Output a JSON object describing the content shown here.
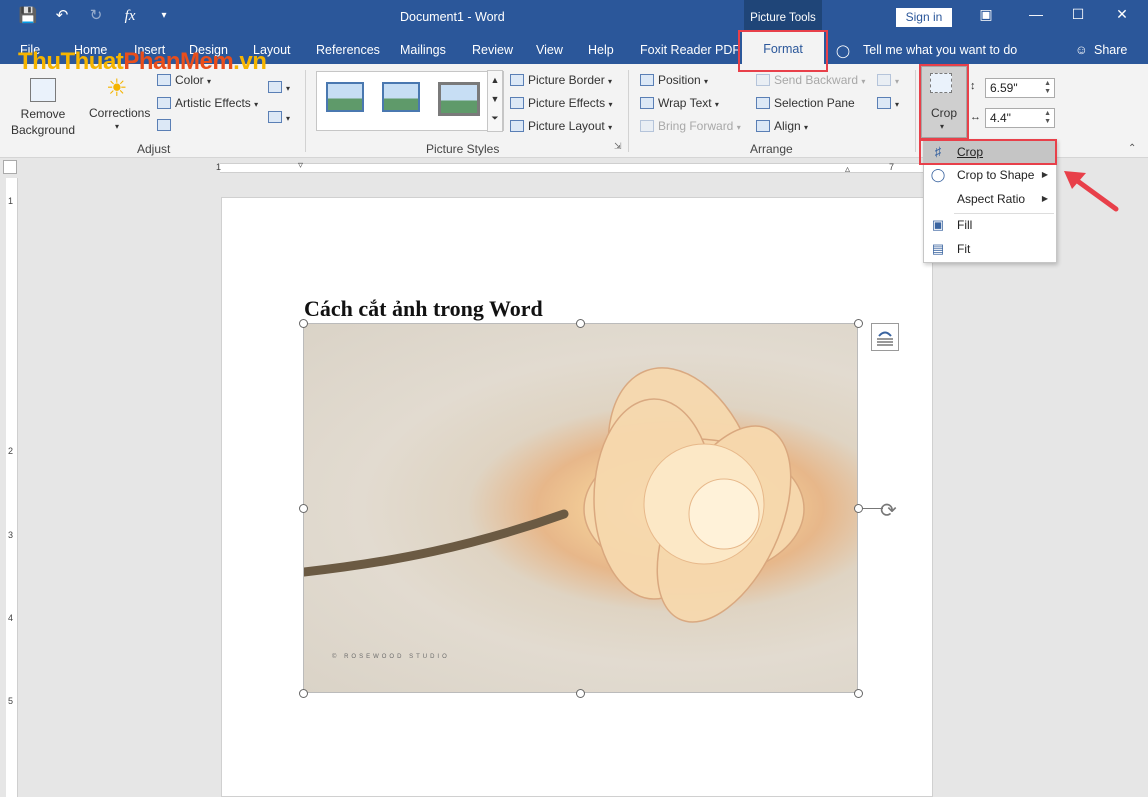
{
  "app": {
    "document_title": "Document1  -  Word",
    "context_tools": "Picture Tools",
    "sign_in": "Sign in",
    "share": "Share",
    "tell_me": "Tell me what you want to do"
  },
  "watermark": {
    "part1": "ThuThuat",
    "part2": "PhanMem",
    "part3": ".vn"
  },
  "tabs": [
    {
      "label": "File"
    },
    {
      "label": "Home"
    },
    {
      "label": "Insert"
    },
    {
      "label": "Design"
    },
    {
      "label": "Layout"
    },
    {
      "label": "References"
    },
    {
      "label": "Mailings"
    },
    {
      "label": "Review"
    },
    {
      "label": "View"
    },
    {
      "label": "Help"
    },
    {
      "label": "Foxit Reader PDF"
    },
    {
      "label": "Format"
    }
  ],
  "ribbon": {
    "adjust": {
      "remove_background": "Remove Background",
      "corrections": "Corrections",
      "color": "Color",
      "artistic_effects": "Artistic Effects",
      "group_label": "Adjust"
    },
    "picture_styles": {
      "border": "Picture Border",
      "effects": "Picture Effects",
      "layout": "Picture Layout",
      "group_label": "Picture Styles"
    },
    "arrange": {
      "position": "Position",
      "wrap_text": "Wrap Text",
      "bring_forward": "Bring Forward",
      "send_backward": "Send Backward",
      "selection_pane": "Selection Pane",
      "align": "Align",
      "group_label": "Arrange"
    },
    "size": {
      "crop": "Crop",
      "height": "6.59\"",
      "width": "4.4\""
    }
  },
  "ruler": {
    "h_numbers": [
      "1",
      "7"
    ],
    "v_numbers": [
      "1",
      "2",
      "3",
      "4",
      "5"
    ]
  },
  "document": {
    "heading": "Cách cắt ảnh trong Word",
    "picture_caption": "© ROSEWOOD STUDIO"
  },
  "crop_menu": [
    {
      "label": "Crop",
      "icon": "crop-icon",
      "submenu": false
    },
    {
      "label": "Crop to Shape",
      "icon": "crop-to-shape-icon",
      "submenu": true
    },
    {
      "label": "Aspect Ratio",
      "icon": "",
      "submenu": true
    },
    {
      "label": "Fill",
      "icon": "fill-icon",
      "submenu": false
    },
    {
      "label": "Fit",
      "icon": "fit-icon",
      "submenu": false
    }
  ],
  "colors": {
    "title_bar": "#2b579a",
    "highlight": "#e8404a",
    "ribbon": "#f3f3f3"
  }
}
